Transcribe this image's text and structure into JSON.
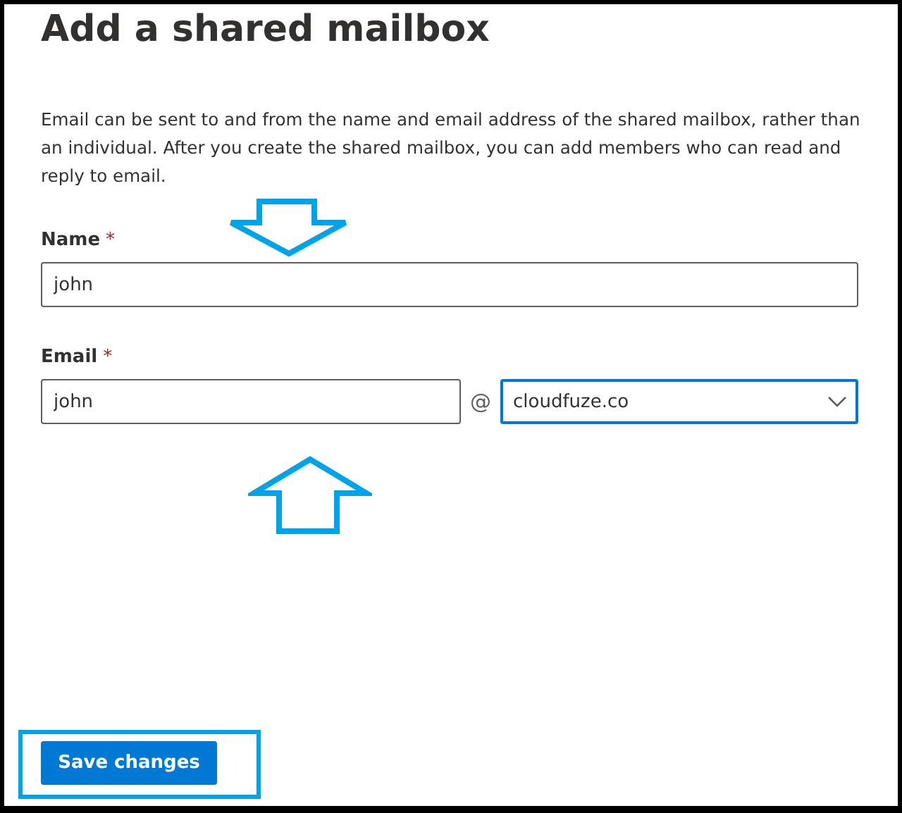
{
  "title": "Add a shared mailbox",
  "description": "Email can be sent to and from the name and email address of the shared mailbox, rather than an individual. After you create the shared mailbox, you can add members who can read and reply to email.",
  "name_field": {
    "label": "Name",
    "required_mark": "*",
    "value": "john"
  },
  "email_field": {
    "label": "Email",
    "required_mark": "*",
    "value": "john",
    "separator": "@",
    "domain": "cloudfuze.co"
  },
  "save_button": {
    "label": "Save changes"
  }
}
